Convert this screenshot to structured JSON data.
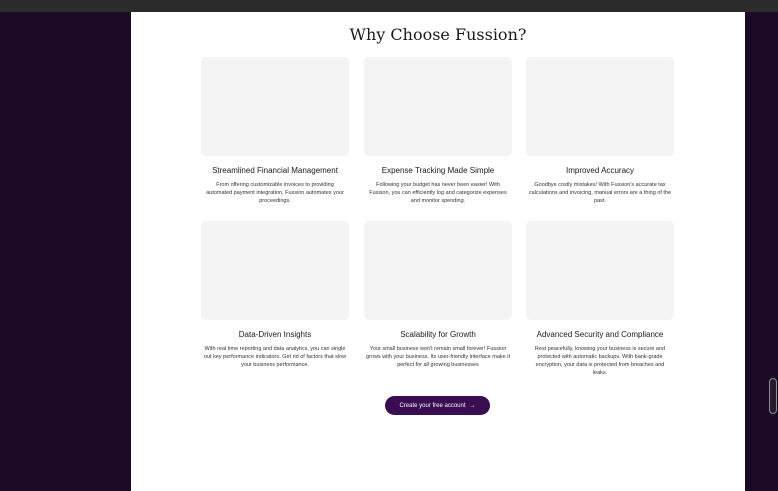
{
  "section": {
    "title": "Why Choose Fussion?"
  },
  "features": [
    {
      "title": "Streamlined Financial Management",
      "description": "From offering customizable invoices to providing automated payment integration, Fussion automates your proceedings."
    },
    {
      "title": "Expense Tracking Made Simple",
      "description": "Following your budget has never been easier! With Fussion, you can efficiently log and categorize expenses and monitor spending."
    },
    {
      "title": "Improved Accuracy",
      "description": "Goodbye costly mistakes! With Fussion's accurate tax calculations and invoicing, manual errors are a thing of the past."
    },
    {
      "title": "Data-Driven Insights",
      "description": "With real time reporting and data analytics, you can single out key performance indicators. Get rid of factors that slow your business performance."
    },
    {
      "title": "Scalability for Growth",
      "description": "Your small business won't remain small forever! Fussion grows with your business. Its user-friendly interface make it perfect for all growing businesses"
    },
    {
      "title": "Advanced Security and Compliance",
      "description": "Rest peacefully, knowing your business is secure and protected with automatic backups. With bank-grade encryption, your data is protected from breaches and leaks."
    }
  ],
  "cta": {
    "label": "Create your free account",
    "icon": "arrow-right-icon",
    "arrow": "→"
  },
  "colors": {
    "brand": "#3a0c52",
    "background": "#1c0a26"
  }
}
